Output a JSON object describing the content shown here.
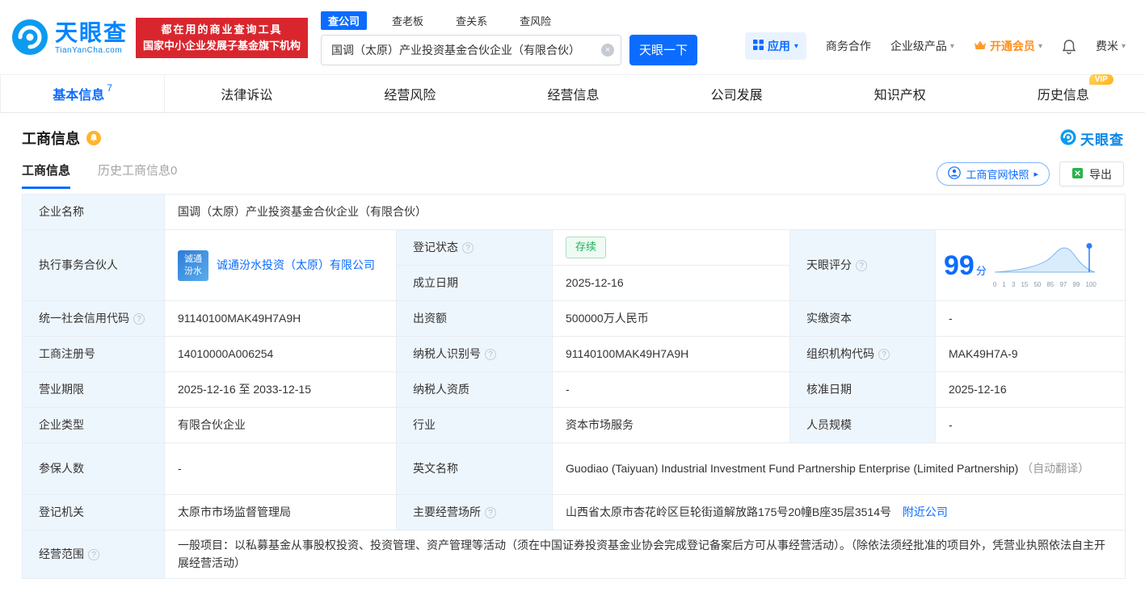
{
  "brand": {
    "name": "天眼查",
    "domain": "TianYanCha.com",
    "promo_line1": "都在用的商业查询工具",
    "promo_line2": "国家中小企业发展子基金旗下机构"
  },
  "search": {
    "tabs": [
      {
        "label": "查公司"
      },
      {
        "label": "查老板"
      },
      {
        "label": "查关系"
      },
      {
        "label": "查风险"
      }
    ],
    "value": "国调（太原）产业投资基金合伙企业（有限合伙）",
    "button": "天眼一下"
  },
  "topnav": {
    "apps": "应用",
    "cooperation": "商务合作",
    "enterprise": "企业级产品",
    "vip": "开通会员",
    "user": "费米"
  },
  "tabs": [
    {
      "label": "基本信息",
      "count": "7"
    },
    {
      "label": "法律诉讼"
    },
    {
      "label": "经营风险"
    },
    {
      "label": "经营信息"
    },
    {
      "label": "公司发展"
    },
    {
      "label": "知识产权"
    },
    {
      "label": "历史信息",
      "tag": "VIP"
    }
  ],
  "section": {
    "title": "工商信息",
    "brand": "天眼查",
    "subtabs": [
      {
        "label": "工商信息"
      },
      {
        "label": "历史工商信息0"
      }
    ],
    "snapshot_button": "工商官网快照",
    "export_button": "导出"
  },
  "fields": {
    "company_name": {
      "label": "企业名称",
      "value": "国调（太原）产业投资基金合伙企业（有限合伙）"
    },
    "executive_partner": {
      "label": "执行事务合伙人",
      "logo_line1": "诚通",
      "logo_line2": "汾水",
      "link": "诚通汾水投资（太原）有限公司"
    },
    "reg_status": {
      "label": "登记状态",
      "value": "存续"
    },
    "establish_date": {
      "label": "成立日期",
      "value": "2025-12-16"
    },
    "credit_code": {
      "label": "统一社会信用代码",
      "value": "91140100MAK49H7A9H"
    },
    "capital": {
      "label": "出资额",
      "value": "500000万人民币"
    },
    "paid_capital": {
      "label": "实缴资本",
      "value": "-"
    },
    "reg_number": {
      "label": "工商注册号",
      "value": "14010000A006254"
    },
    "taxpayer_id": {
      "label": "纳税人识别号",
      "value": "91140100MAK49H7A9H"
    },
    "org_code": {
      "label": "组织机构代码",
      "value": "MAK49H7A-9"
    },
    "business_term": {
      "label": "营业期限",
      "value": "2025-12-16 至 2033-12-15"
    },
    "taxpayer_quality": {
      "label": "纳税人资质",
      "value": "-"
    },
    "approval_date": {
      "label": "核准日期",
      "value": "2025-12-16"
    },
    "company_type": {
      "label": "企业类型",
      "value": "有限合伙企业"
    },
    "industry": {
      "label": "行业",
      "value": "资本市场服务"
    },
    "staff_size": {
      "label": "人员规模",
      "value": "-"
    },
    "insured_count": {
      "label": "参保人数",
      "value": "-"
    },
    "english_name": {
      "label": "英文名称",
      "value": "Guodiao (Taiyuan) Industrial Investment Fund Partnership Enterprise (Limited Partnership)",
      "note": "（自动翻译）"
    },
    "reg_authority": {
      "label": "登记机关",
      "value": "太原市市场监督管理局"
    },
    "business_address": {
      "label": "主要经营场所",
      "value": "山西省太原市杏花岭区巨轮街道解放路175号20幢B座35层3514号",
      "link": "附近公司"
    },
    "business_scope": {
      "label": "经营范围",
      "value": "一般项目：以私募基金从事股权投资、投资管理、资产管理等活动（须在中国证券投资基金业协会完成登记备案后方可从事经营活动）。（除依法须经批准的项目外，凭营业执照依法自主开展经营活动）"
    }
  },
  "score": {
    "label": "天眼评分",
    "value": "99",
    "unit": "分",
    "ticks": [
      "0",
      "1",
      "3",
      "15",
      "50",
      "85",
      "97",
      "99",
      "100"
    ]
  },
  "icons": {
    "help": "?",
    "caret": "▾",
    "clear": "×",
    "arrow": "▸"
  }
}
